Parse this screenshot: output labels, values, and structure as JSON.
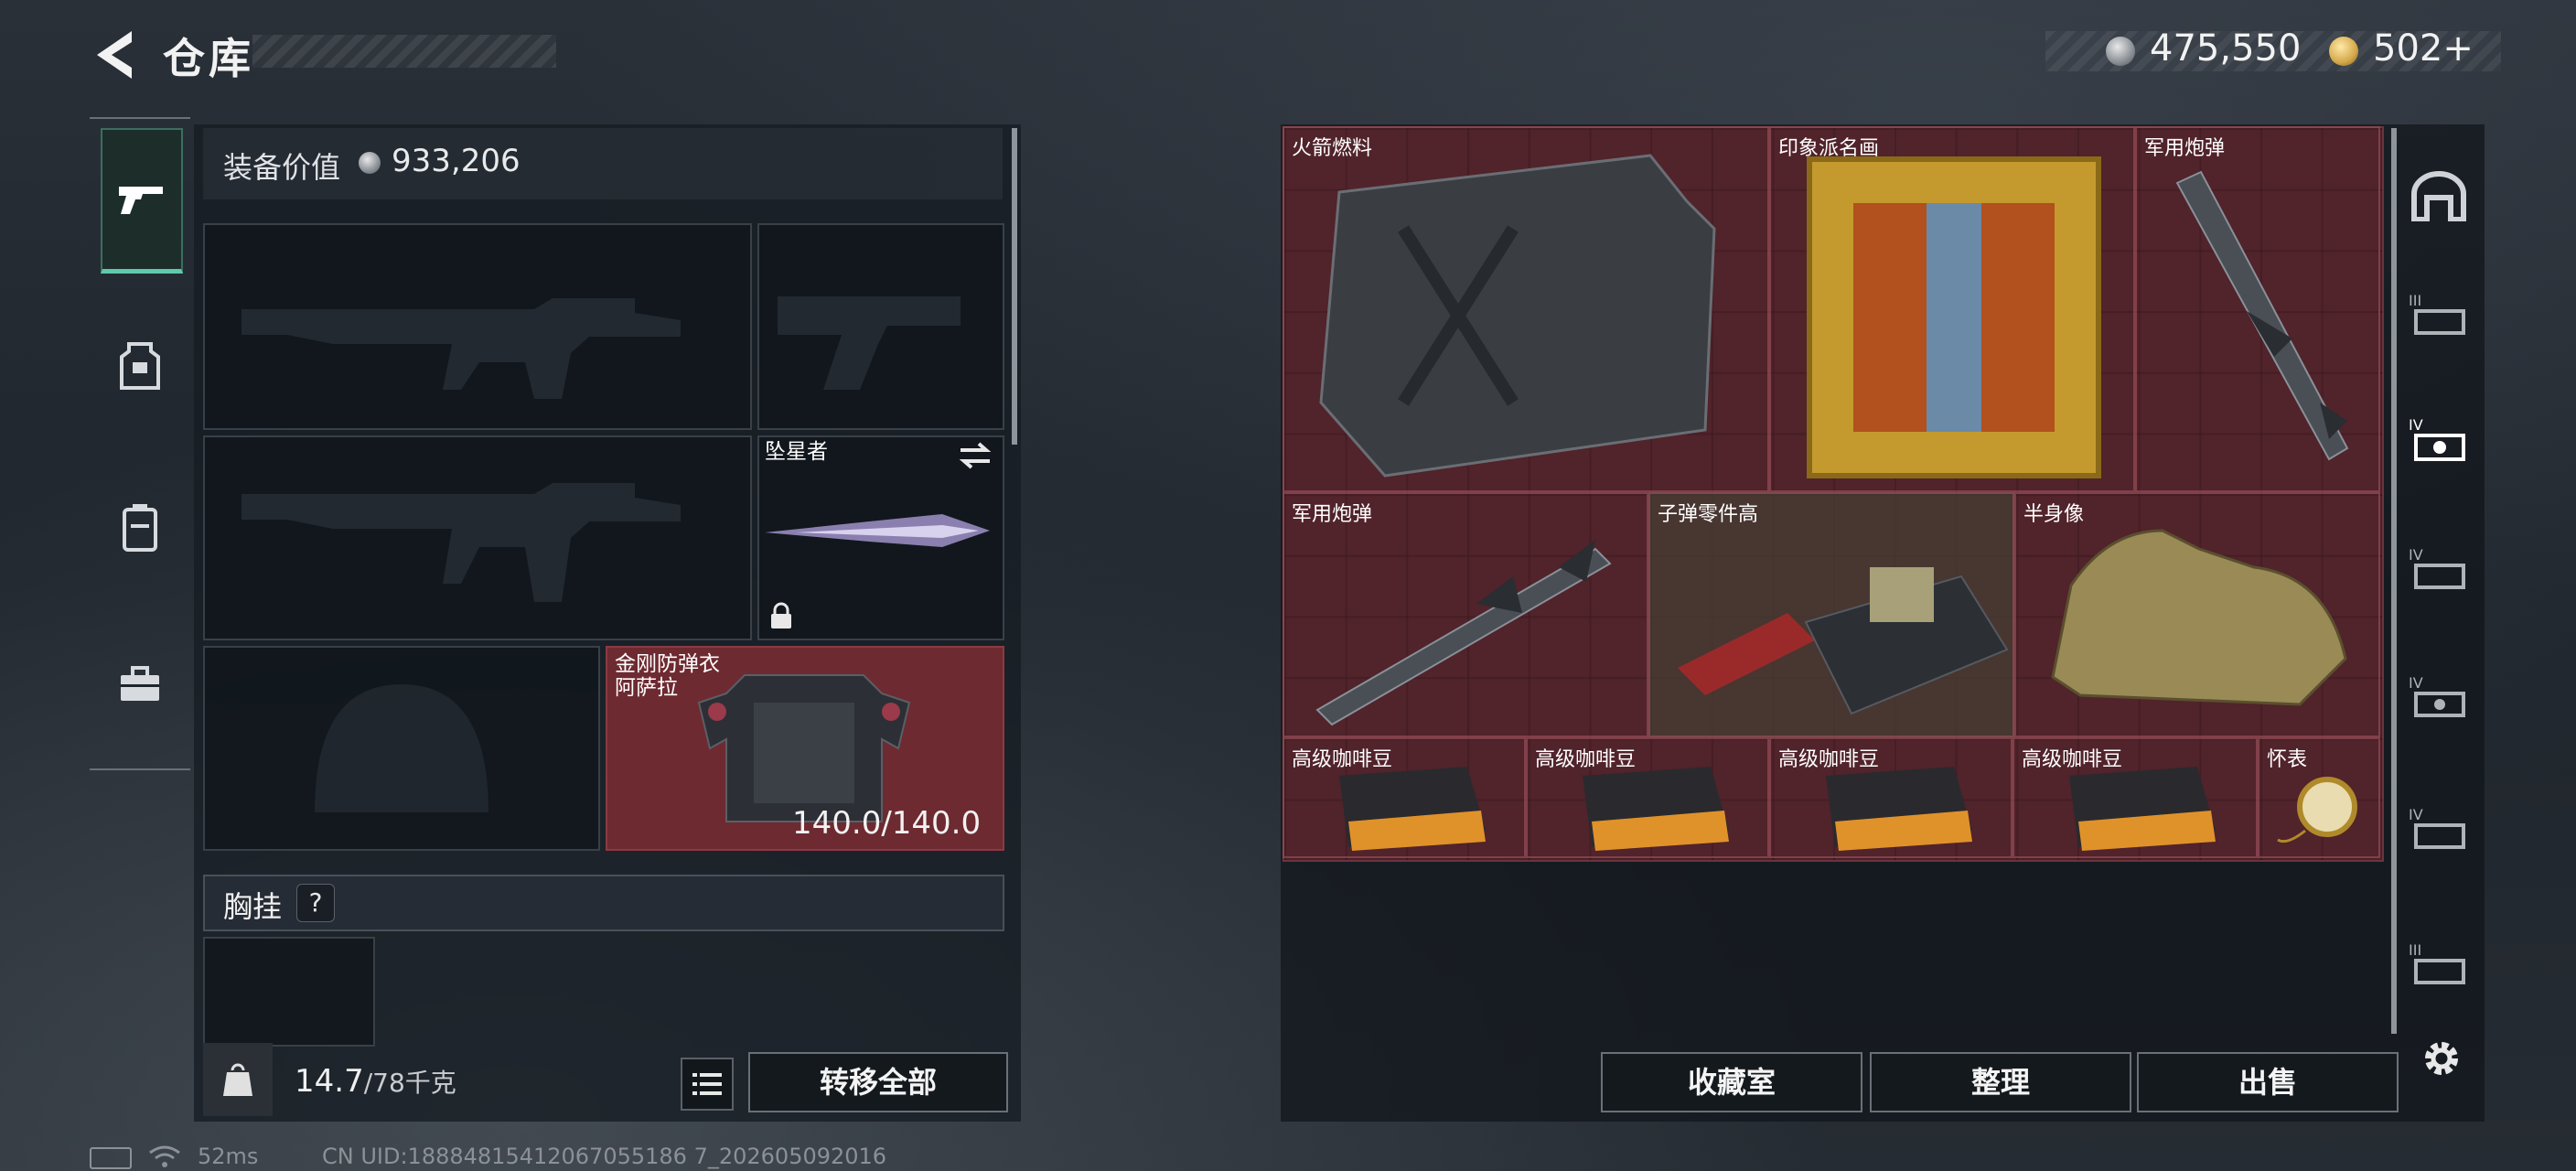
{
  "header": {
    "title": "仓库",
    "silver_amount": "475,550",
    "gold_amount": "502",
    "gold_plus": "+"
  },
  "left_nav": {
    "items": [
      "pistol-icon",
      "armor-icon",
      "backpack-icon",
      "briefcase-icon"
    ],
    "active": "pistol-icon"
  },
  "loadout": {
    "equip_value_label": "装备价值",
    "equip_value": "933,206",
    "melee": {
      "name": "坠星者",
      "locked": true
    },
    "armor": {
      "name_line1": "金刚防弹衣",
      "name_line2": "阿萨拉",
      "durability": "140.0/140.0"
    },
    "chest_rig": {
      "label": "胸挂",
      "help": "?"
    }
  },
  "footer_left": {
    "weight_current": "14.7",
    "weight_capacity": "/78千克",
    "transfer_all": "转移全部"
  },
  "storage": {
    "items": [
      {
        "key": "rocket_fuel",
        "name": "火箭燃料"
      },
      {
        "key": "painting",
        "name": "印象派名画"
      },
      {
        "key": "missile_1",
        "name": "军用炮弹"
      },
      {
        "key": "missile_2",
        "name": "军用炮弹"
      },
      {
        "key": "bullet_parts",
        "name": "子弹零件高"
      },
      {
        "key": "bust",
        "name": "半身像"
      },
      {
        "key": "coffee_1",
        "name": "高级咖啡豆"
      },
      {
        "key": "coffee_2",
        "name": "高级咖啡豆"
      },
      {
        "key": "coffee_3",
        "name": "高级咖啡豆"
      },
      {
        "key": "coffee_4",
        "name": "高级咖啡豆"
      },
      {
        "key": "pocket_watch",
        "name": "怀表"
      }
    ],
    "buttons": {
      "collection": "收藏室",
      "tidy": "整理",
      "sell": "出售"
    }
  },
  "right_nav": {
    "items": [
      "safehouse-icon",
      "tier-3-storage-icon",
      "tier-4-storage-icon",
      "tier-4-storage-icon",
      "tier-4-storage-icon",
      "tier-4-storage-icon",
      "tier-3-storage-icon"
    ],
    "tier_labels": [
      "III",
      "IV",
      "IV",
      "IV",
      "IV",
      "III"
    ]
  },
  "status_bar": {
    "ping": "52ms",
    "uid": "CN UID:18884815412067055186 7_202605092016"
  },
  "colors": {
    "accent": "#5fc9ae",
    "grid_bg": "#4a2129",
    "armor_bg": "#6e2a31"
  }
}
